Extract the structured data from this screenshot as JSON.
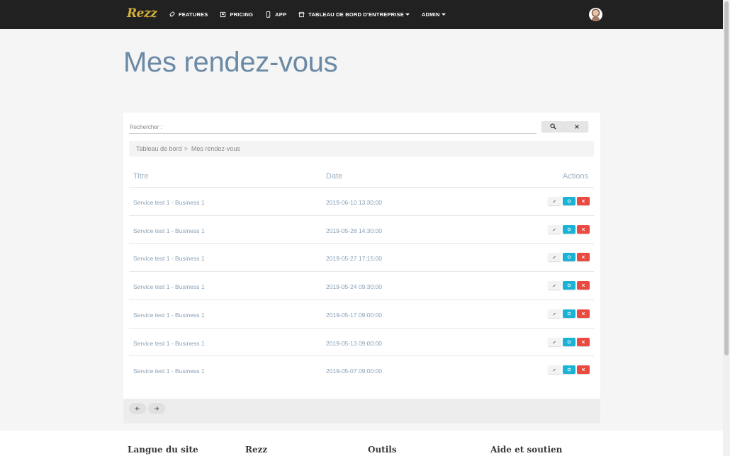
{
  "nav": {
    "brand": "Rezz",
    "items": [
      {
        "label": "FEATURES",
        "icon": "rocket-icon"
      },
      {
        "label": "PRICING",
        "icon": "tag-icon"
      },
      {
        "label": "APP",
        "icon": "mobile-icon"
      },
      {
        "label": "TABLEAU DE BORD D'ENTREPRISE",
        "icon": "store-icon",
        "dropdown": true
      },
      {
        "label": "ADMIN",
        "dropdown": true
      }
    ]
  },
  "page": {
    "title": "Mes rendez-vous"
  },
  "search": {
    "label": "Rechercher :",
    "value": ""
  },
  "breadcrumb": {
    "root": "Tableau de bord",
    "separator": ">",
    "current": "Mes rendez-vous"
  },
  "table": {
    "headers": {
      "title": "Titre",
      "date": "Date",
      "actions": "Actions"
    },
    "rows": [
      {
        "title": "Service test 1 - Business 1",
        "date": "2019-06-10 13:30:00"
      },
      {
        "title": "Service test 1 - Business 1",
        "date": "2019-05-28 14:30:00"
      },
      {
        "title": "Service test 1 - Business 1",
        "date": "2019-05-27 17:15:00"
      },
      {
        "title": "Service test 1 - Business 1",
        "date": "2019-05-24 09:30:00"
      },
      {
        "title": "Service test 1 - Business 1",
        "date": "2019-05-17 09:00:00"
      },
      {
        "title": "Service test 1 - Business 1",
        "date": "2019-05-13 09:00:00"
      },
      {
        "title": "Service test 1 - Business 1",
        "date": "2019-05-07 09:00:00"
      }
    ]
  },
  "footer": {
    "columns": [
      "Langue du site",
      "Rezz",
      "Outils",
      "Aide et soutien"
    ]
  },
  "colors": {
    "navbar": "#212121",
    "brand": "#d4b13a",
    "title": "#6b8aa5",
    "view": "#1ab3d6",
    "delete": "#ea4a3f"
  }
}
